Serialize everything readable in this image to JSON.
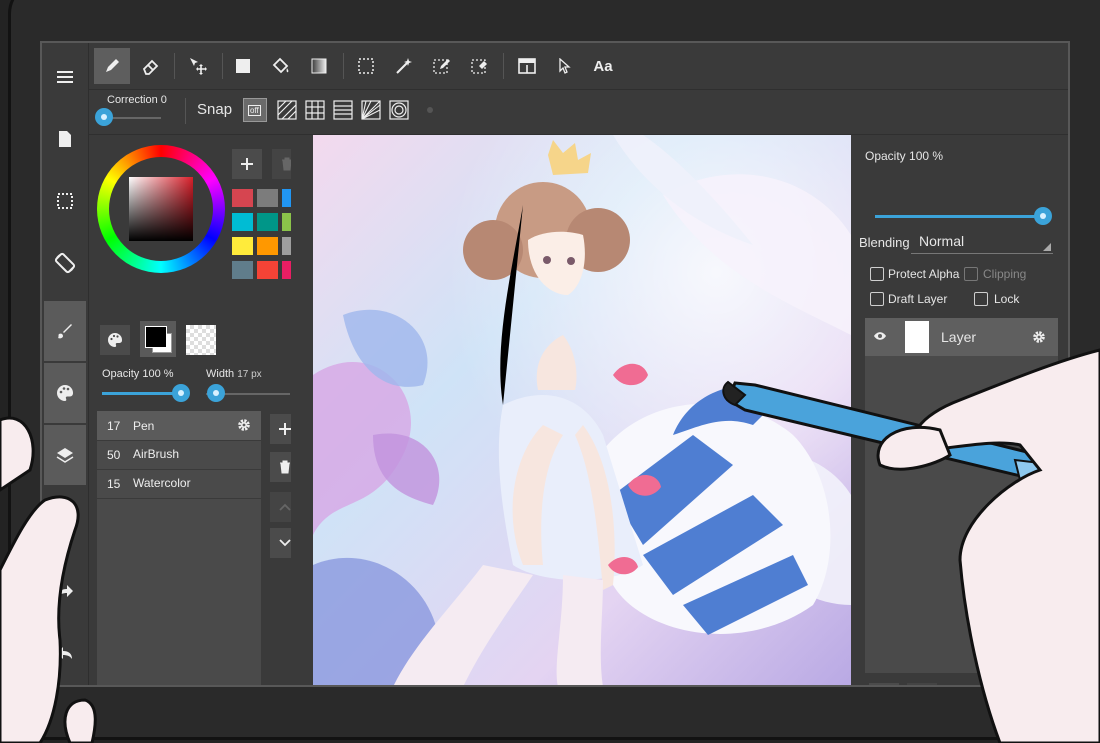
{
  "toolbar": {
    "tools": [
      "pen-tool",
      "eraser-tool",
      "move-tool",
      "fill-rect-tool",
      "bucket-tool",
      "gradient-tool",
      "select-rect-tool",
      "magic-wand-tool",
      "select-pen-tool",
      "select-eraser-tool",
      "frame-divider-tool",
      "operation-tool",
      "text-tool"
    ],
    "text_tool_label": "Aa"
  },
  "options": {
    "correction_label": "Correction 0",
    "snap_label": "Snap",
    "snap_off_label": "off"
  },
  "brush_panel": {
    "opacity_label": "Opacity 100 %",
    "width_label": "Width",
    "width_value": "17 px",
    "opacity_value": 100,
    "swatches": [
      "#d64550",
      "#7c7c7c",
      "#2196f3",
      "#00bcd4",
      "#009688",
      "#8bc34a",
      "#ffeb3b",
      "#ff9800",
      "#9e9e9e",
      "#607d8b",
      "#f44336",
      "#e91e63"
    ],
    "brushes": [
      {
        "size": "17",
        "name": "Pen"
      },
      {
        "size": "50",
        "name": "AirBrush"
      },
      {
        "size": "15",
        "name": "Watercolor"
      }
    ]
  },
  "layer_panel": {
    "opacity_label": "Opacity 100 %",
    "opacity_value": 100,
    "blending_label": "Blending",
    "blending_value": "Normal",
    "protect_alpha_label": "Protect Alpha",
    "clipping_label": "Clipping",
    "draft_layer_label": "Draft Layer",
    "lock_label": "Lock",
    "layers": [
      {
        "name": "Layer"
      }
    ]
  },
  "colors": {
    "accent": "#3ba3d9",
    "panel": "#3a3a3a",
    "selected": "#5e5e5e"
  }
}
